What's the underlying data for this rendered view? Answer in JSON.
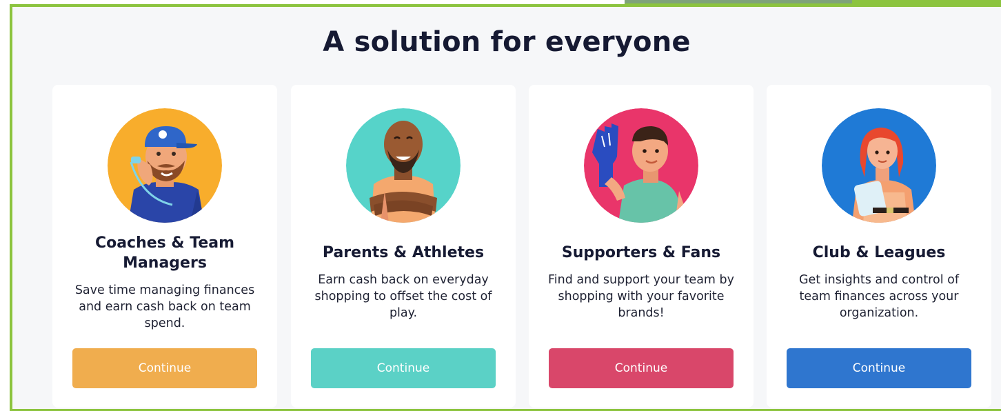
{
  "heading": "A solution for everyone",
  "cards": [
    {
      "title": "Coaches & Team Managers",
      "description": "Save time managing finances and earn cash back on team spend.",
      "button_label": "Continue",
      "button_color": "#f0ad4e",
      "avatar_bg": "#f8ad2c",
      "avatar_icon": "coach-avatar-icon"
    },
    {
      "title": "Parents & Athletes",
      "description": "Earn cash back on everyday shopping to offset the cost of play.",
      "button_label": "Continue",
      "button_color": "#5bd1c6",
      "avatar_bg": "#56d3c9",
      "avatar_icon": "athlete-avatar-icon"
    },
    {
      "title": "Supporters & Fans",
      "description": "Find and support your team by shopping with your favorite brands!",
      "button_label": "Continue",
      "button_color": "#d9476a",
      "avatar_bg": "#e9356a",
      "avatar_icon": "fan-avatar-icon"
    },
    {
      "title": "Club & Leagues",
      "description": "Get insights and control of team finances across your organization.",
      "button_label": "Continue",
      "button_color": "#2f76cf",
      "avatar_bg": "#1f7ad6",
      "avatar_icon": "league-avatar-icon"
    }
  ],
  "colors": {
    "frame_border": "#8cc43f",
    "heading_text": "#161a33",
    "page_bg": "#f6f7f9"
  }
}
